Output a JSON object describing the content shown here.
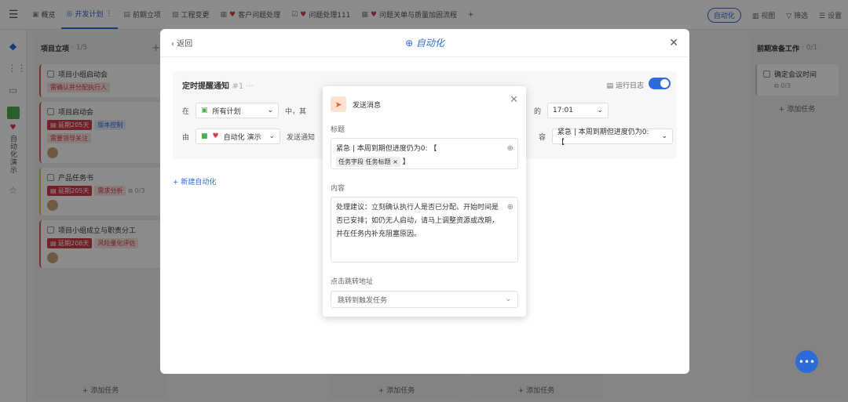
{
  "topbar": {
    "menu": "☰",
    "tabs": [
      {
        "label": "概览",
        "icon": "▣",
        "heart": false,
        "active": false
      },
      {
        "label": "开发计划",
        "icon": "◎",
        "heart": false,
        "active": true,
        "extra": "⋮"
      },
      {
        "label": "前期立项",
        "icon": "▤",
        "heart": false,
        "active": false
      },
      {
        "label": "工程变更",
        "icon": "▧",
        "heart": false,
        "active": false
      },
      {
        "label": "客户问题处理",
        "icon": "▦",
        "heart": true,
        "active": false
      },
      {
        "label": "问题处理111",
        "icon": "☑",
        "heart": true,
        "active": false
      },
      {
        "label": "问题关单与质量加固流程",
        "icon": "▦",
        "heart": true,
        "active": false
      }
    ],
    "add_tab": "+",
    "automation": "自动化",
    "view": "视图",
    "filter": "筛选",
    "settings": "设置"
  },
  "sidebar": {
    "vertical_text": "自动化演示",
    "star": "☆"
  },
  "columns": {
    "left": {
      "title": "项目立项",
      "count": "· 1/5",
      "add": "+",
      "cards": [
        {
          "title": "项目小组启动会",
          "tags": [
            {
              "text": "需确认并分配执行人",
              "cls": "red"
            }
          ],
          "avatar": false
        },
        {
          "title": "项目启动会",
          "tags": [
            {
              "text": "▤ 延期205天",
              "cls": "redf"
            },
            {
              "text": "版本控制",
              "cls": "blue"
            },
            {
              "text": "需要领导关注",
              "cls": "red"
            }
          ],
          "avatar": true
        },
        {
          "title": "产品任务书",
          "tags": [
            {
              "text": "▤ 延期205天",
              "cls": "redf"
            },
            {
              "text": "需求分析",
              "cls": "red"
            }
          ],
          "meta": "⧉ 0/3",
          "avatar": true,
          "yellow": true
        },
        {
          "title": "项目小组成立与职责分工",
          "tags": [
            {
              "text": "▤ 延期208天",
              "cls": "redf"
            },
            {
              "text": "风险量化评估",
              "cls": "red"
            }
          ],
          "avatar": true
        }
      ],
      "add_task": "+ 添加任务"
    },
    "right": {
      "title": "前期准备工作",
      "count": "· 0/1",
      "card": "确定会议时间",
      "meta": "⧉ 0/3",
      "add_task": "+ 添加任务"
    },
    "mid_add_task": "+ 添加任务"
  },
  "automation_panel": {
    "back": "‹ 返回",
    "title": "⊕ 自动化",
    "close": "✕",
    "rule": {
      "title": "定时提醒通知",
      "sub": "#1 ···",
      "log": "▤ 运行日志",
      "row1": {
        "lead": "在",
        "plan": "所有计划",
        "mid": "中，其",
        "of": "的",
        "time": "17:01"
      },
      "row2": {
        "lead": "由",
        "actor": "自动化 演示",
        "action": "发送通知",
        "content_label": "容",
        "content": "紧急 | 本周到期但进度仍为0: 【"
      }
    },
    "new_automation": "+ 新建自动化"
  },
  "modal": {
    "icon": "➤",
    "title": "发送消息",
    "close": "✕",
    "title_label": "标题",
    "title_text": "紧急 | 本周到期但进度仍为0: 【",
    "chip": "任务字段 任务标题 ×",
    "title_end": "】",
    "content_label": "内容",
    "content_text": "处理建议：立刻确认执行人是否已分配、开始时间是否已安排；如仍无人启动，请马上调整资源或改期，并在任务内补充阻塞原因。",
    "link_label": "点击跳转地址",
    "link_value": "跳转到触发任务",
    "plus": "⊕",
    "chevron": "⌄"
  }
}
